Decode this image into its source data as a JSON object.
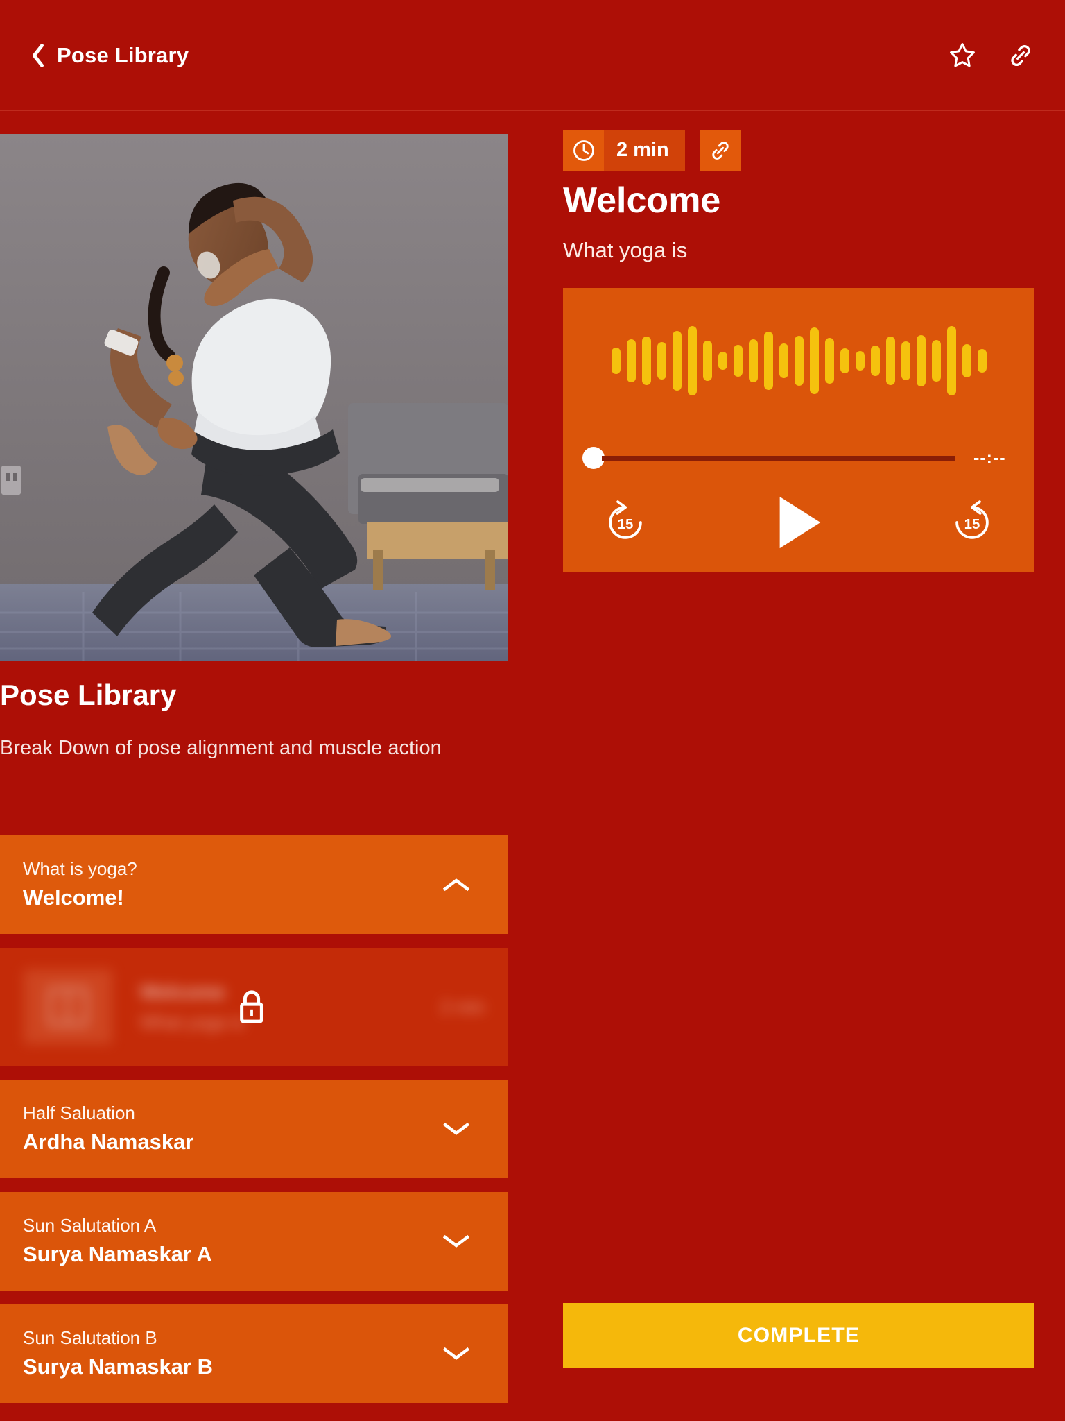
{
  "header": {
    "back_label": "Pose Library",
    "back_icon": "chevron-left-icon",
    "favorite_icon": "star-outline-icon",
    "share_icon": "link-icon"
  },
  "lesson": {
    "title": "Pose Library",
    "description": "Break Down of pose alignment and muscle action",
    "hero_alt": "yoga-pose-photo"
  },
  "accordion": [
    {
      "sub": "What is yoga?",
      "main": "Welcome!",
      "state": "expanded",
      "chevron": "chevron-up-icon"
    },
    {
      "sub": "Half Saluation",
      "main": "Ardha Namaskar",
      "state": "collapsed",
      "chevron": "chevron-down-icon"
    },
    {
      "sub": "Sun Salutation A",
      "main": "Surya Namaskar A",
      "state": "collapsed",
      "chevron": "chevron-down-icon"
    },
    {
      "sub": "Sun Salutation B",
      "main": "Surya Namaskar B",
      "state": "collapsed",
      "chevron": "chevron-down-icon"
    }
  ],
  "locked_row": {
    "title": "Welcome",
    "subtitle": "What yoga is",
    "duration": "2 min",
    "lock_icon": "lock-icon",
    "thumb_icon": "book-icon"
  },
  "detail": {
    "duration_badge": "2 min",
    "clock_icon": "clock-icon",
    "link_icon": "link-icon",
    "title": "Welcome",
    "subtitle": "What yoga is"
  },
  "player": {
    "time_remaining": "--:--",
    "progress_percent": 0,
    "rewind_label": "15",
    "rewind_icon": "rewind-15-icon",
    "play_icon": "play-icon",
    "forward_label": "15",
    "forward_icon": "forward-15-icon",
    "waveform": [
      38,
      62,
      70,
      54,
      86,
      100,
      58,
      26,
      46,
      62,
      84,
      50,
      72,
      96,
      66,
      36,
      28,
      44,
      70,
      56,
      74,
      60,
      100,
      48,
      34
    ]
  },
  "footer": {
    "complete_label": "COMPLETE"
  },
  "colors": {
    "brand_red": "#AD0F06",
    "accent_orange": "#DB550A",
    "badge_orange": "#E2590B",
    "badge_dark_orange": "#D14209",
    "waveform_yellow": "#F5C20E",
    "complete_yellow": "#F5B80B",
    "track_dark": "#8A1E06"
  }
}
